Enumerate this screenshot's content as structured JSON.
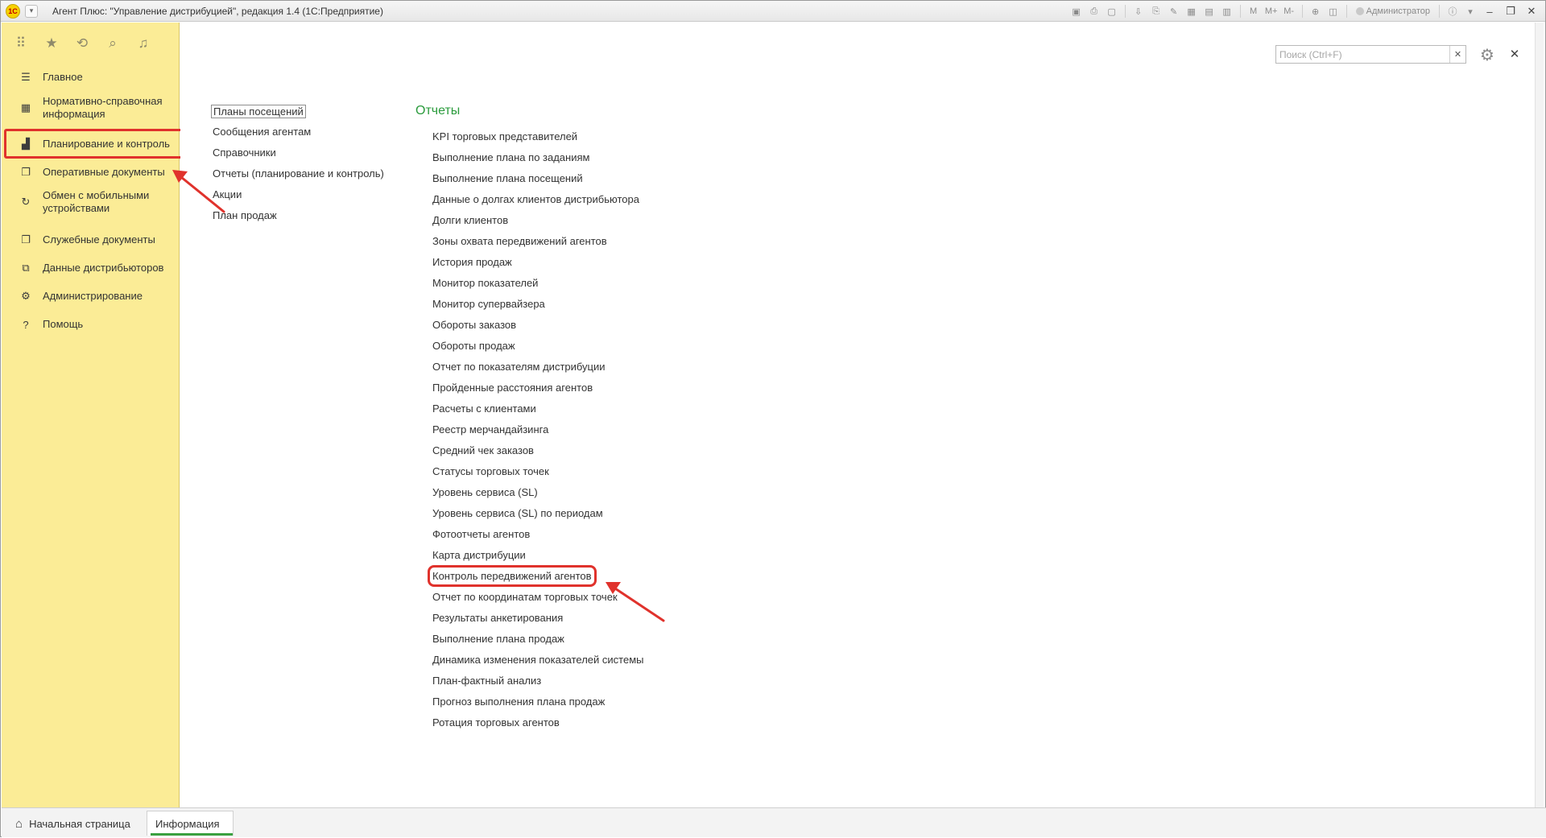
{
  "window": {
    "title": "Агент Плюс: \"Управление дистрибуцией\", редакция 1.4  (1С:Предприятие)",
    "logo": "1С",
    "user": "Администратор",
    "toolbar_labels": [
      "M",
      "M+",
      "M-"
    ]
  },
  "sidebar": {
    "toolbar_icons": [
      "apps-grid-icon",
      "star-icon",
      "history-icon",
      "search-icon",
      "bell-icon"
    ],
    "items": [
      {
        "label": "Главное",
        "icon": "menu-lines-icon"
      },
      {
        "label": "Нормативно-справочная информация",
        "icon": "grid-icon"
      },
      {
        "label": "Планирование и контроль",
        "icon": "chart-icon",
        "highlighted": true
      },
      {
        "label": "Оперативные документы",
        "icon": "documents-icon"
      },
      {
        "label": "Обмен с мобильными устройствами",
        "icon": "sync-icon"
      },
      {
        "label": "Служебные документы",
        "icon": "documents-icon"
      },
      {
        "label": "Данные дистрибьюторов",
        "icon": "distributor-icon"
      },
      {
        "label": "Администрирование",
        "icon": "gear-icon"
      },
      {
        "label": "Помощь",
        "icon": "help-icon"
      }
    ]
  },
  "main": {
    "search_placeholder": "Поиск (Ctrl+F)",
    "left_links": [
      "Планы посещений",
      "Сообщения агентам",
      "Справочники",
      "Отчеты (планирование и контроль)",
      "Акции",
      "План продаж"
    ],
    "reports_title": "Отчеты",
    "reports": [
      "KPI торговых представителей",
      "Выполнение плана по заданиям",
      "Выполнение плана посещений",
      "Данные о долгах клиентов дистрибьютора",
      "Долги клиентов",
      "Зоны охвата передвижений агентов",
      "История продаж",
      "Монитор показателей",
      "Монитор супервайзера",
      "Обороты заказов",
      "Обороты продаж",
      "Отчет по показателям дистрибуции",
      "Пройденные расстояния агентов",
      "Расчеты с клиентами",
      "Реестр мерчандайзинга",
      "Средний чек заказов",
      "Статусы торговых точек",
      "Уровень сервиса (SL)",
      "Уровень сервиса (SL) по периодам",
      "Фотоотчеты агентов",
      "Карта дистрибуции",
      "Контроль передвижений агентов",
      "Отчет по координатам торговых точек",
      "Результаты анкетирования",
      "Выполнение плана продаж",
      "Динамика изменения показателей системы",
      "План-фактный анализ",
      "Прогноз выполнения плана продаж",
      "Ротация торговых агентов"
    ],
    "highlighted_report": "Контроль передвижений агентов"
  },
  "bottom": {
    "home_tab": "Начальная страница",
    "info_tab": "Информация"
  },
  "colors": {
    "sidebar_bg": "#fbec96",
    "accent_green": "#2a9b3c",
    "highlight_red": "#e0322c"
  }
}
